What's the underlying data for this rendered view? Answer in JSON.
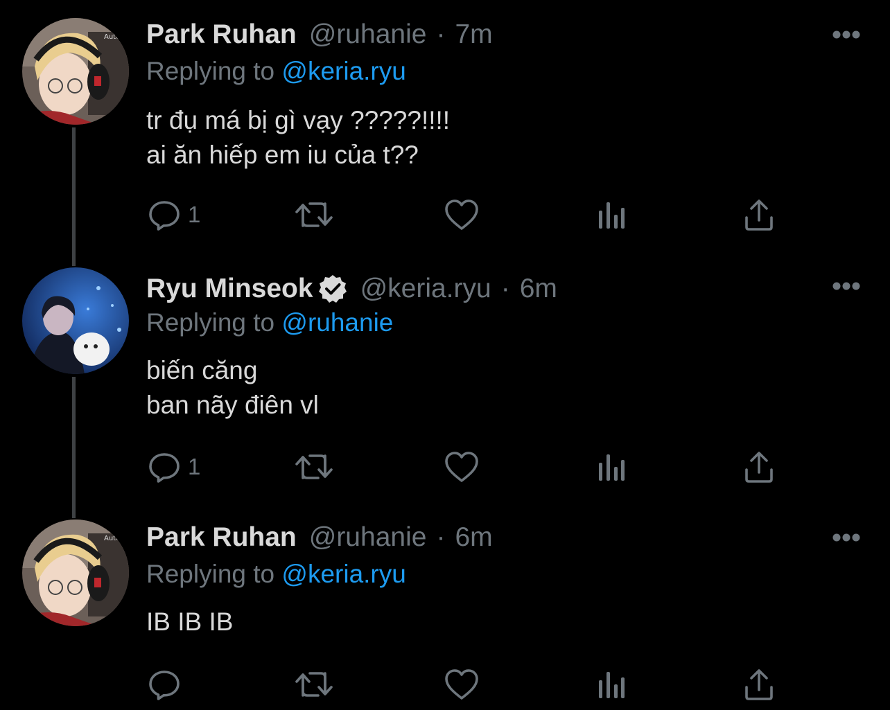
{
  "tweets": [
    {
      "name": "Park Ruhan",
      "handle": "@ruhanie",
      "separator": "·",
      "time": "7m",
      "verified": false,
      "replying_prefix": "Replying to",
      "replying_to": "@keria.ryu",
      "lines": [
        "tr đụ má bị gì vạy ?????!!!!",
        "ai ăn hiếp em iu của t??"
      ],
      "reply_count": "1",
      "avatar_icon": "user-avatar-headset"
    },
    {
      "name": "Ryu Minseok",
      "handle": "@keria.ryu",
      "separator": "·",
      "time": "6m",
      "verified": true,
      "replying_prefix": "Replying to",
      "replying_to": "@ruhanie",
      "lines": [
        "biến căng",
        "ban nãy điên vl"
      ],
      "reply_count": "1",
      "avatar_icon": "user-avatar-blue-stage"
    },
    {
      "name": "Park Ruhan",
      "handle": "@ruhanie",
      "separator": "·",
      "time": "6m",
      "verified": false,
      "replying_prefix": "Replying to",
      "replying_to": "@keria.ryu",
      "lines": [
        "IB IB IB"
      ],
      "reply_count": "",
      "avatar_icon": "user-avatar-headset"
    }
  ],
  "action_icons": [
    "reply-icon",
    "retweet-icon",
    "like-icon",
    "analytics-icon",
    "share-icon"
  ],
  "colors": {
    "background": "#000000",
    "text": "#d9d9d9",
    "muted": "#6e767d",
    "accent": "#1d9bf0",
    "thread_line": "#3e4144"
  }
}
